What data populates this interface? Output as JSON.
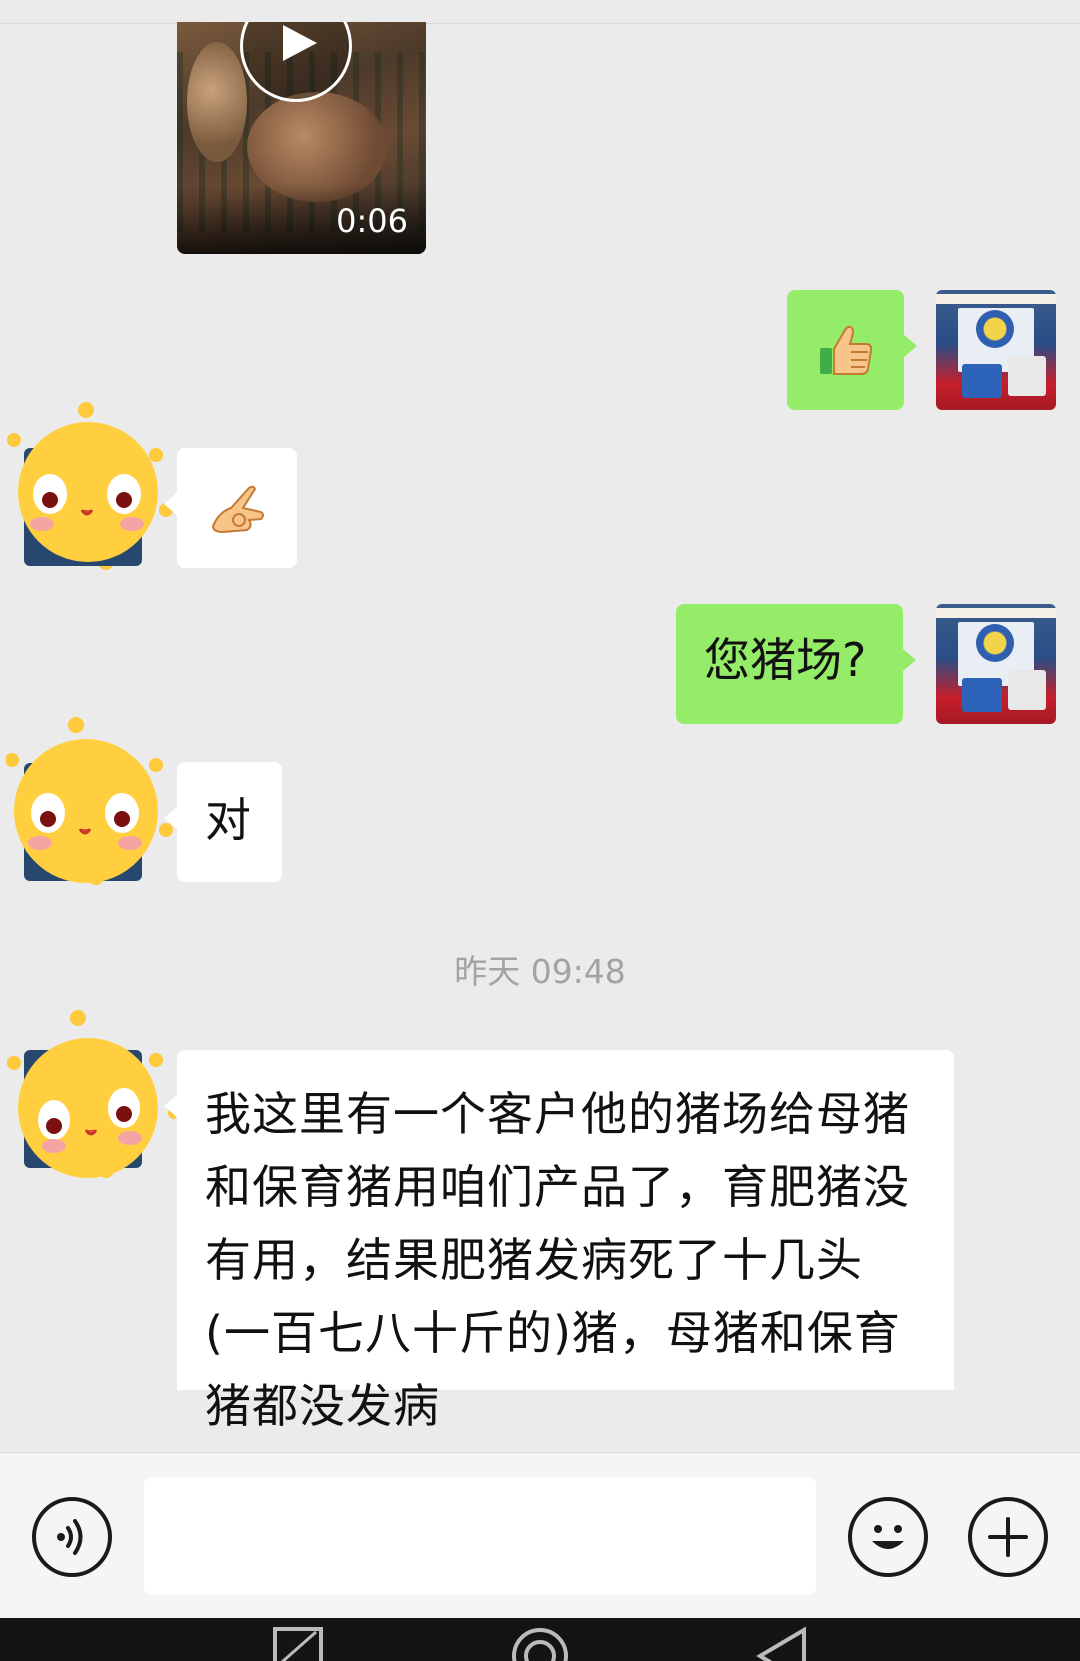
{
  "messages": [
    {
      "id": "video",
      "side": "left",
      "type": "video",
      "duration": "0:06"
    },
    {
      "id": "thumbs-up",
      "side": "right",
      "type": "emoji",
      "icon": "thumbs-up-emoji",
      "sender": "self"
    },
    {
      "id": "ok-hand",
      "side": "left",
      "type": "emoji",
      "icon": "ok-hand-emoji",
      "sender": "contact"
    },
    {
      "id": "question",
      "side": "right",
      "type": "text",
      "text": "您猪场?",
      "sender": "self"
    },
    {
      "id": "answer",
      "side": "left",
      "type": "text",
      "text": "对",
      "sender": "contact"
    },
    {
      "id": "long",
      "side": "left",
      "type": "text",
      "text": "我这里有一个客户他的猪场给母猪和保育猪用咱们产品了，育肥猪没有用，结果肥猪发病死了十几头(一百七八十斤的)猪，母猪和保育猪都没发病",
      "sender": "contact"
    }
  ],
  "timestamp": "昨天 09:48",
  "input": {
    "value": "",
    "placeholder": ""
  },
  "colors": {
    "background": "#ebebeb",
    "bubble_self": "#95ec69",
    "bubble_other": "#ffffff",
    "timestamp": "#a3a3a3",
    "input_bar": "#f5f5f7",
    "nav_bar": "#141414"
  },
  "icons": {
    "voice": "voice-icon",
    "emoji": "smiley-icon",
    "more": "plus-icon",
    "play": "play-icon"
  }
}
